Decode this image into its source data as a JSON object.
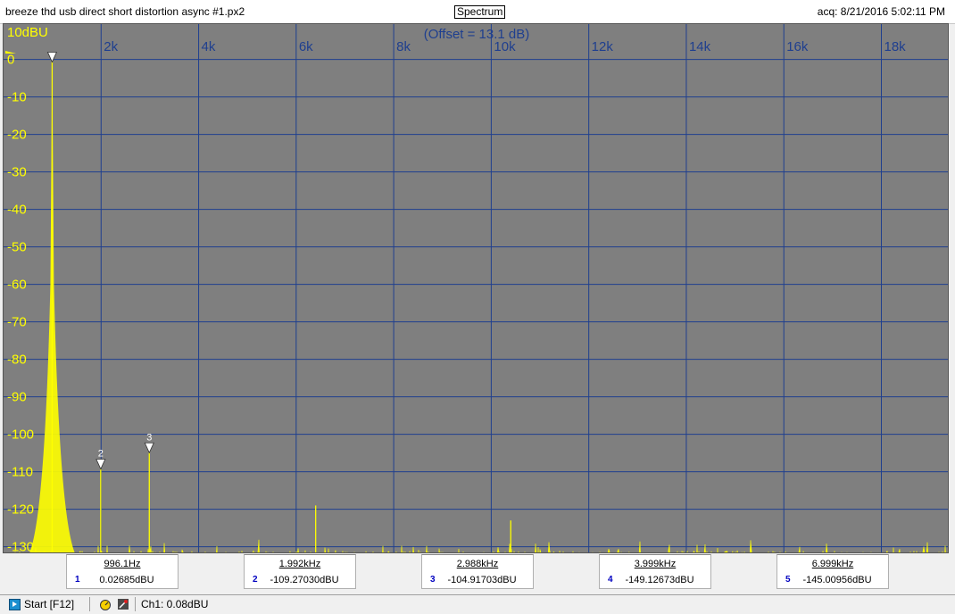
{
  "window": {
    "title_left": "breeze thd usb direct short distortion async #1.px2",
    "view_label": "Spectrum",
    "acq_time": "acq: 8/21/2016 5:02:11 PM"
  },
  "chart_data": {
    "type": "line",
    "annotation": "(Offset = 13.1 dB)",
    "ylabel": "dBU",
    "x_unit": "Hz",
    "xlim": [
      0,
      19400
    ],
    "ylim": [
      -132,
      8
    ],
    "x_ticks": [
      2000,
      4000,
      6000,
      8000,
      10000,
      12000,
      14000,
      16000,
      18000
    ],
    "x_tick_labels": [
      "2k",
      "4k",
      "6k",
      "8k",
      "10k",
      "12k",
      "14k",
      "16k",
      "18k"
    ],
    "y_ticks": [
      10,
      0,
      -10,
      -20,
      -30,
      -40,
      -50,
      -60,
      -70,
      -80,
      -90,
      -100,
      -110,
      -120,
      -130
    ],
    "y_tick_labels": [
      "10dBU",
      "0",
      "-10",
      "-20",
      "-30",
      "-40",
      "-50",
      "-60",
      "-70",
      "-80",
      "-90",
      "-100",
      "-110",
      "-120",
      "-130"
    ],
    "grid": true,
    "noise_floor": -133,
    "series": [
      {
        "color": "#ffff00",
        "peaks": [
          {
            "x": 996.1,
            "y": 0.03
          },
          {
            "x": 1992,
            "y": -109.27
          },
          {
            "x": 2988,
            "y": -104.92
          },
          {
            "x": 6400,
            "y": -119
          },
          {
            "x": 10400,
            "y": -123
          }
        ]
      }
    ],
    "markers": [
      {
        "id": "2",
        "x": 1992,
        "y": -109.27
      },
      {
        "id": "3",
        "x": 2988,
        "y": -104.92
      }
    ]
  },
  "marker_readouts": [
    {
      "num": "",
      "freq": "996.1Hz",
      "level": "0.02685dBU"
    },
    {
      "num": "2",
      "freq": "1.992kHz",
      "level": "-109.27030dBU"
    },
    {
      "num": "3",
      "freq": "2.988kHz",
      "level": "-104.91703dBU"
    },
    {
      "num": "4",
      "freq": "3.999kHz",
      "level": "-149.12673dBU"
    },
    {
      "num": "5",
      "freq": "6.999kHz",
      "level": "-145.00956dBU"
    }
  ],
  "marker_readout_first_num": "1",
  "statusbar": {
    "start_label": "Start [F12]",
    "channel_info": "Ch1: 0.08dBU"
  },
  "colors": {
    "plot_bg": "#7f7f7f",
    "grid": "#1f3f8f",
    "trace": "#ffff00",
    "axis_labels_x": "#1f3f8f",
    "axis_labels_y": "#ffff00"
  }
}
